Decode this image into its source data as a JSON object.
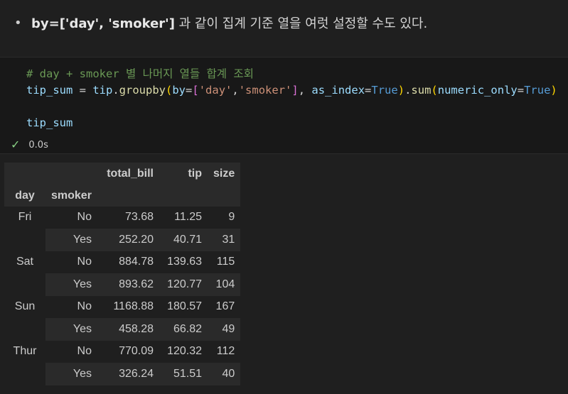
{
  "markdown": {
    "bold_code": "by=['day', 'smoker']",
    "text": " 과 같이 집계 기준 열을 여럿 설정할 수도 있다."
  },
  "code_cell": {
    "line1_comment": "# day + smoker 별 나머지 열들 합계 조회",
    "line2": {
      "var": "tip_sum",
      "eq": " = ",
      "obj": "tip",
      "dot1": ".",
      "fn1": "groupby",
      "p1_open": "(",
      "by_kw": "by",
      "eq2": "=",
      "br_open": "[",
      "s1": "'day'",
      "comma1": ",",
      "s2": "'smoker'",
      "br_close": "]",
      "comma2": ", ",
      "as_index_kw": "as_index",
      "eq3": "=",
      "true1": "True",
      "p1_close": ")",
      "dot2": ".",
      "fn2": "sum",
      "p2_open": "(",
      "numeric_kw": "numeric_only",
      "eq4": "=",
      "true2": "True",
      "p2_close": ")"
    },
    "line4": "tip_sum",
    "status_check": "✓",
    "status_time": "0.0s"
  },
  "dataframe": {
    "columns": [
      "total_bill",
      "tip",
      "size"
    ],
    "index_names": [
      "day",
      "smoker"
    ],
    "groups": [
      {
        "day": "Fri",
        "rows": [
          {
            "smoker": "No",
            "total_bill": "73.68",
            "tip": "11.25",
            "size": "9"
          },
          {
            "smoker": "Yes",
            "total_bill": "252.20",
            "tip": "40.71",
            "size": "31"
          }
        ]
      },
      {
        "day": "Sat",
        "rows": [
          {
            "smoker": "No",
            "total_bill": "884.78",
            "tip": "139.63",
            "size": "115"
          },
          {
            "smoker": "Yes",
            "total_bill": "893.62",
            "tip": "120.77",
            "size": "104"
          }
        ]
      },
      {
        "day": "Sun",
        "rows": [
          {
            "smoker": "No",
            "total_bill": "1168.88",
            "tip": "180.57",
            "size": "167"
          },
          {
            "smoker": "Yes",
            "total_bill": "458.28",
            "tip": "66.82",
            "size": "49"
          }
        ]
      },
      {
        "day": "Thur",
        "rows": [
          {
            "smoker": "No",
            "total_bill": "770.09",
            "tip": "120.32",
            "size": "112"
          },
          {
            "smoker": "Yes",
            "total_bill": "326.24",
            "tip": "51.51",
            "size": "40"
          }
        ]
      }
    ]
  }
}
